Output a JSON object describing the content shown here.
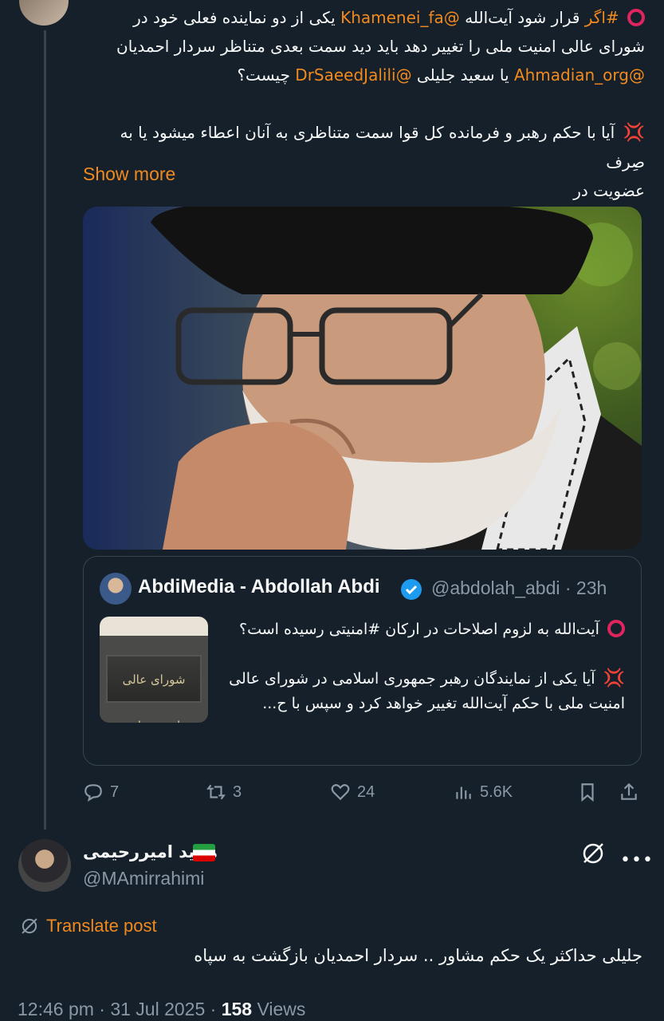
{
  "tweet": {
    "line1_mention": "@Khamenei_fa",
    "line1_text_a": "یکی از دو نماینده فعلی خود در",
    "line1_text_b": "قرار شود آیت‌الله",
    "line1_hashtag": "#اگر",
    "line2": "شورای عالی امنیت ملی را تغییر دهد باید دید سمت بعدی متناظر سردار احمدیان",
    "line3_mention_a": "@Ahmadian_org",
    "line3_text_a": "یا سعید جلیلی",
    "line3_mention_b": "@DrSaeedJalili",
    "line3_text_b": "چیست؟",
    "line4": "آیا با حکم رهبر و فرمانده کل قوا سمت متناظری به آنان اعطاء میشود یا به صِرف",
    "line5": "عضویت در",
    "show_more": "Show more"
  },
  "quoted": {
    "name": "AbdiMedia - Abdollah Abdi",
    "handle_time": "@abdolah_abdi · 23h",
    "thumb_text": "شورای عالی امنیت ملی",
    "para1_text": "آیت‌الله به لزوم اصلاحات در ارکان",
    "para1_hashtag": "#امنیتی",
    "para1_end": "رسیده است؟",
    "para2": "آیا یکی از نمایندگان رهبر جمهوری اسلامی در شورای عالی امنیت ملی با حکم آیت‌الله تغییر خواهد کرد و سپس با ح..."
  },
  "actions": {
    "replies": "7",
    "reposts": "3",
    "likes": "24",
    "views": "5.6K"
  },
  "reply": {
    "name": "مجید امیررحیمی",
    "handle": "@MAmirrahimi",
    "translate": "Translate post",
    "text": "جلیلی حداکثر یک حکم مشاور .. سردار احمدیان بازگشت به سپاه",
    "time_date": "12:46 pm · 31 Jul 2025 · ",
    "views_count": "158",
    "views_label": " Views"
  },
  "colors": {
    "background": "#15202b",
    "accent": "#f18a1e",
    "muted": "#8b98a5",
    "verified": "#1d9bf0"
  }
}
